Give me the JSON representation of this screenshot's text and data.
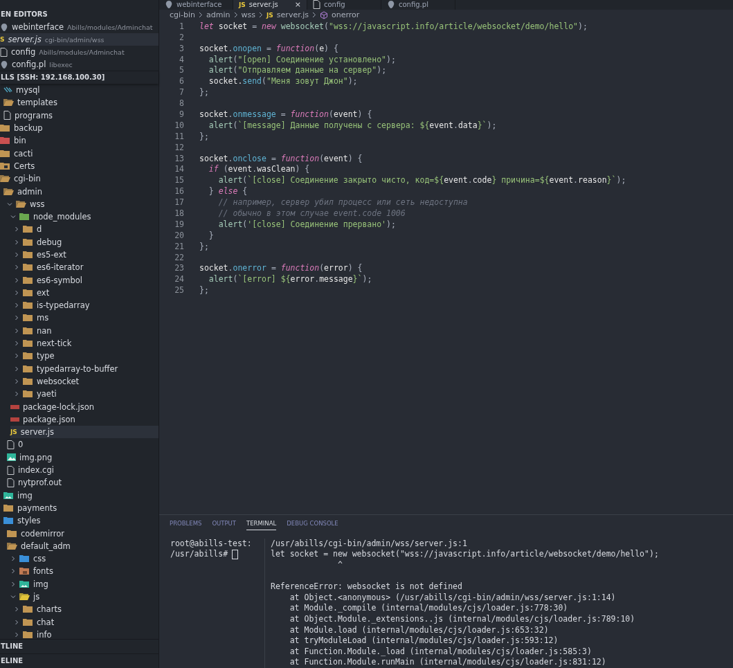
{
  "editor_tabs": [
    {
      "label": "webinterface",
      "kind": "blob",
      "selected": false
    },
    {
      "label": "server.js",
      "kind": "js",
      "badge": "JS",
      "selected": true,
      "close": "×"
    },
    {
      "label": "config",
      "kind": "file",
      "selected": false
    },
    {
      "label": "config.pl",
      "kind": "blob",
      "selected": false
    }
  ],
  "sidebar": {
    "open_editors": {
      "title": "EN EDITORS",
      "items": [
        {
          "name": "webinterface",
          "path": "Abills/modules/Adminchat",
          "kind": "blob",
          "selected": false,
          "preview": false
        },
        {
          "name": "server.js",
          "path": "cgi-bin/admin/wss",
          "kind": "js",
          "badge": "S",
          "selected": true,
          "preview": true
        },
        {
          "name": "config",
          "path": "Abills/modules/Adminchat",
          "kind": "file",
          "selected": false,
          "preview": false
        },
        {
          "name": "config.pl",
          "path": "libexec",
          "kind": "blob",
          "selected": false,
          "preview": false
        }
      ]
    },
    "workspace_title": "LLS [SSH: 192.168.100.30]",
    "tree": [
      {
        "children": [
          {
            "label": "mysql",
            "kind": "db"
          },
          {
            "label": "templates",
            "kind": "folder-open"
          },
          {
            "label": "programs",
            "kind": "file"
          }
        ]
      },
      {
        "label": "backup",
        "kind": "folder"
      },
      {
        "label": "bin",
        "kind": "folder-red"
      },
      {
        "label": "cacti",
        "kind": "folder"
      },
      {
        "label": "Certs",
        "kind": "folder-lock"
      },
      {
        "label": "cgi-bin",
        "kind": "folder-open",
        "children": [
          {
            "label": "admin",
            "kind": "folder-open",
            "children": [
              {
                "label": "wss",
                "kind": "folder-open",
                "expanded": true,
                "children": [
                  {
                    "label": "node_modules",
                    "kind": "folder-green",
                    "expanded": true,
                    "children": [
                      {
                        "label": "d",
                        "kind": "folder",
                        "expanded": false
                      },
                      {
                        "label": "debug",
                        "kind": "folder",
                        "expanded": false
                      },
                      {
                        "label": "es5-ext",
                        "kind": "folder",
                        "expanded": false
                      },
                      {
                        "label": "es6-iterator",
                        "kind": "folder",
                        "expanded": false
                      },
                      {
                        "label": "es6-symbol",
                        "kind": "folder",
                        "expanded": false
                      },
                      {
                        "label": "ext",
                        "kind": "folder",
                        "expanded": false
                      },
                      {
                        "label": "is-typedarray",
                        "kind": "folder",
                        "expanded": false
                      },
                      {
                        "label": "ms",
                        "kind": "folder",
                        "expanded": false
                      },
                      {
                        "label": "nan",
                        "kind": "folder",
                        "expanded": false
                      },
                      {
                        "label": "next-tick",
                        "kind": "folder",
                        "expanded": false
                      },
                      {
                        "label": "type",
                        "kind": "folder",
                        "expanded": false
                      },
                      {
                        "label": "typedarray-to-buffer",
                        "kind": "folder",
                        "expanded": false
                      },
                      {
                        "label": "websocket",
                        "kind": "folder",
                        "expanded": false
                      },
                      {
                        "label": "yaeti",
                        "kind": "folder",
                        "expanded": false
                      }
                    ]
                  },
                  {
                    "label": "package-lock.json",
                    "kind": "json",
                    "selected": false
                  },
                  {
                    "label": "package.json",
                    "kind": "json",
                    "selected": false
                  },
                  {
                    "label": "server.js",
                    "kind": "js",
                    "badge": "JS",
                    "selected": true
                  }
                ]
              },
              {
                "label": "0",
                "kind": "file"
              },
              {
                "label": "img.png",
                "kind": "image"
              },
              {
                "label": "index.cgi",
                "kind": "file"
              },
              {
                "label": "nytprof.out",
                "kind": "file"
              }
            ]
          },
          {
            "label": "img",
            "kind": "folder-image"
          },
          {
            "label": "payments",
            "kind": "folder"
          },
          {
            "label": "styles",
            "kind": "folder-blue",
            "children": [
              {
                "label": "codemirror",
                "kind": "folder"
              },
              {
                "label": "default_adm",
                "kind": "folder-open",
                "children": [
                  {
                    "label": "css",
                    "kind": "folder-blue",
                    "expanded": false
                  },
                  {
                    "label": "fonts",
                    "kind": "folder-font",
                    "expanded": false
                  },
                  {
                    "label": "img",
                    "kind": "folder-image",
                    "expanded": false
                  },
                  {
                    "label": "js",
                    "kind": "folder-yellow",
                    "expanded": true,
                    "children": [
                      {
                        "label": "charts",
                        "kind": "folder",
                        "expanded": false
                      },
                      {
                        "label": "chat",
                        "kind": "folder",
                        "expanded": false
                      },
                      {
                        "label": "info",
                        "kind": "folder",
                        "expanded": false
                      }
                    ]
                  }
                ]
              }
            ]
          }
        ]
      }
    ],
    "bottom_sections": [
      "TLINE",
      "ELINE"
    ]
  },
  "breadcrumbs": [
    {
      "label": "cgi-bin",
      "kind": "folder"
    },
    {
      "label": "admin",
      "kind": "folder"
    },
    {
      "label": "wss",
      "kind": "folder"
    },
    {
      "label": "server.js",
      "kind": "file",
      "badge": "JS"
    },
    {
      "label": "onerror",
      "kind": "symbol"
    }
  ],
  "code": [
    {
      "n": "1",
      "segs": [
        {
          "kind": "keyword",
          "text": "let"
        },
        {
          "kind": "name",
          "text": " socket "
        },
        {
          "kind": "punct",
          "text": "= "
        },
        {
          "kind": "keyword",
          "text": "new "
        },
        {
          "kind": "call",
          "text": "websocket"
        },
        {
          "kind": "punct",
          "text": "("
        },
        {
          "kind": "string",
          "text": "\"wss://javascript.info/article/websocket/demo/hello\""
        },
        {
          "kind": "punct",
          "text": ");"
        }
      ]
    },
    {
      "n": "2"
    },
    {
      "n": "3",
      "segs": [
        {
          "kind": "name",
          "text": "socket"
        },
        {
          "kind": "punct",
          "text": "."
        },
        {
          "kind": "property",
          "text": "onopen"
        },
        {
          "kind": "punct",
          "text": " = "
        },
        {
          "kind": "keyword",
          "text": "function"
        },
        {
          "kind": "punct",
          "text": "("
        },
        {
          "kind": "name",
          "text": "e"
        },
        {
          "kind": "punct",
          "text": ") {"
        }
      ]
    },
    {
      "n": "4",
      "segs": [
        {
          "kind": "call",
          "text": "  alert"
        },
        {
          "kind": "punct",
          "text": "("
        },
        {
          "kind": "string",
          "text": "\"[open] Соединение установлено\""
        },
        {
          "kind": "punct",
          "text": ");"
        }
      ]
    },
    {
      "n": "5",
      "segs": [
        {
          "kind": "call",
          "text": "  alert"
        },
        {
          "kind": "punct",
          "text": "("
        },
        {
          "kind": "string",
          "text": "\"Отправляем данные на сервер\""
        },
        {
          "kind": "punct",
          "text": ");"
        }
      ]
    },
    {
      "n": "6",
      "segs": [
        {
          "kind": "name",
          "text": "  socket."
        },
        {
          "kind": "property",
          "text": "send"
        },
        {
          "kind": "punct",
          "text": "("
        },
        {
          "kind": "string",
          "text": "\"Меня зовут Джон\""
        },
        {
          "kind": "punct",
          "text": ");"
        }
      ]
    },
    {
      "n": "7",
      "segs": [
        {
          "kind": "punct",
          "text": "};"
        }
      ]
    },
    {
      "n": "8"
    },
    {
      "n": "9",
      "segs": [
        {
          "kind": "name",
          "text": "socket"
        },
        {
          "kind": "punct",
          "text": "."
        },
        {
          "kind": "property",
          "text": "onmessage"
        },
        {
          "kind": "punct",
          "text": " = "
        },
        {
          "kind": "keyword",
          "text": "function"
        },
        {
          "kind": "punct",
          "text": "("
        },
        {
          "kind": "name",
          "text": "event"
        },
        {
          "kind": "punct",
          "text": ") {"
        }
      ]
    },
    {
      "n": "10",
      "segs": [
        {
          "kind": "call",
          "text": "  alert"
        },
        {
          "kind": "punct",
          "text": "("
        },
        {
          "kind": "string",
          "text": "`[message] Данные получены с сервера: ${"
        },
        {
          "kind": "name",
          "text": "event"
        },
        {
          "kind": "punct",
          "text": "."
        },
        {
          "kind": "name",
          "text": "data"
        },
        {
          "kind": "string",
          "text": "}`"
        },
        {
          "kind": "punct",
          "text": ");"
        }
      ]
    },
    {
      "n": "11",
      "segs": [
        {
          "kind": "punct",
          "text": "};"
        }
      ]
    },
    {
      "n": "12"
    },
    {
      "n": "13",
      "segs": [
        {
          "kind": "name",
          "text": "socket"
        },
        {
          "kind": "punct",
          "text": "."
        },
        {
          "kind": "property",
          "text": "onclose"
        },
        {
          "kind": "punct",
          "text": " = "
        },
        {
          "kind": "keyword",
          "text": "function"
        },
        {
          "kind": "punct",
          "text": "("
        },
        {
          "kind": "name",
          "text": "event"
        },
        {
          "kind": "punct",
          "text": ") {"
        }
      ]
    },
    {
      "n": "14",
      "segs": [
        {
          "kind": "keyword",
          "text": "  if"
        },
        {
          "kind": "punct",
          "text": " ("
        },
        {
          "kind": "name",
          "text": "event"
        },
        {
          "kind": "punct",
          "text": "."
        },
        {
          "kind": "name",
          "text": "wasClean"
        },
        {
          "kind": "punct",
          "text": ") {"
        }
      ]
    },
    {
      "n": "15",
      "segs": [
        {
          "kind": "call",
          "text": "    alert"
        },
        {
          "kind": "punct",
          "text": "("
        },
        {
          "kind": "string",
          "text": "`[close] Соединение закрыто чисто, код=${"
        },
        {
          "kind": "name",
          "text": "event"
        },
        {
          "kind": "punct",
          "text": "."
        },
        {
          "kind": "name",
          "text": "code"
        },
        {
          "kind": "string",
          "text": "} причина=${"
        },
        {
          "kind": "name",
          "text": "event"
        },
        {
          "kind": "punct",
          "text": "."
        },
        {
          "kind": "name",
          "text": "reason"
        },
        {
          "kind": "string",
          "text": "}`"
        },
        {
          "kind": "punct",
          "text": ");"
        }
      ]
    },
    {
      "n": "16",
      "segs": [
        {
          "kind": "punct",
          "text": "  } "
        },
        {
          "kind": "keyword",
          "text": "else"
        },
        {
          "kind": "punct",
          "text": " {"
        }
      ]
    },
    {
      "n": "17",
      "segs": [
        {
          "kind": "comment",
          "text": "    // например, сервер убил процесс или сеть недоступна"
        }
      ]
    },
    {
      "n": "18",
      "segs": [
        {
          "kind": "comment",
          "text": "    // обычно в этом случае event.code 1006"
        }
      ]
    },
    {
      "n": "19",
      "segs": [
        {
          "kind": "call",
          "text": "    alert"
        },
        {
          "kind": "punct",
          "text": "("
        },
        {
          "kind": "string",
          "text": "'[close] Соединение прервано'"
        },
        {
          "kind": "punct",
          "text": ");"
        }
      ]
    },
    {
      "n": "20",
      "segs": [
        {
          "kind": "punct",
          "text": "  }"
        }
      ]
    },
    {
      "n": "21",
      "segs": [
        {
          "kind": "punct",
          "text": "};"
        }
      ]
    },
    {
      "n": "22"
    },
    {
      "n": "23",
      "segs": [
        {
          "kind": "name",
          "text": "socket"
        },
        {
          "kind": "punct",
          "text": "."
        },
        {
          "kind": "property",
          "text": "onerror"
        },
        {
          "kind": "punct",
          "text": " = "
        },
        {
          "kind": "keyword",
          "text": "function"
        },
        {
          "kind": "punct",
          "text": "("
        },
        {
          "kind": "name",
          "text": "error"
        },
        {
          "kind": "punct",
          "text": ") {"
        }
      ]
    },
    {
      "n": "24",
      "segs": [
        {
          "kind": "call",
          "text": "  alert"
        },
        {
          "kind": "punct",
          "text": "("
        },
        {
          "kind": "string",
          "text": "`[error] ${"
        },
        {
          "kind": "name",
          "text": "error"
        },
        {
          "kind": "punct",
          "text": "."
        },
        {
          "kind": "name",
          "text": "message"
        },
        {
          "kind": "string",
          "text": "}`"
        },
        {
          "kind": "punct",
          "text": ");"
        }
      ]
    },
    {
      "n": "25",
      "segs": [
        {
          "kind": "punct",
          "text": "};"
        }
      ]
    }
  ],
  "panel": {
    "tabs": [
      {
        "label": "PROBLEMS",
        "selected": false
      },
      {
        "label": "OUTPUT",
        "selected": false
      },
      {
        "label": "TERMINAL",
        "selected": true
      },
      {
        "label": "DEBUG CONSOLE",
        "selected": false
      }
    ],
    "prompt": [
      "root@abills-test:",
      "/usr/abills#"
    ],
    "source_excerpt": [
      "/usr/abills/cgi-bin/admin/wss/server.js:1",
      "let socket = new websocket(\"wss://javascript.info/article/websocket/demo/hello\");",
      "              ^"
    ],
    "error": [
      "ReferenceError: websocket is not defined",
      "    at Object.<anonymous> (/usr/abills/cgi-bin/admin/wss/server.js:1:14)",
      "    at Module._compile (internal/modules/cjs/loader.js:778:30)",
      "    at Object.Module._extensions..js (internal/modules/cjs/loader.js:789:10)",
      "    at Module.load (internal/modules/cjs/loader.js:653:32)",
      "    at tryModuleLoad (internal/modules/cjs/loader.js:593:12)",
      "    at Function.Module._load (internal/modules/cjs/loader.js:585:3)",
      "    at Function.Module.runMain (internal/modules/cjs/loader.js:831:12)"
    ]
  }
}
